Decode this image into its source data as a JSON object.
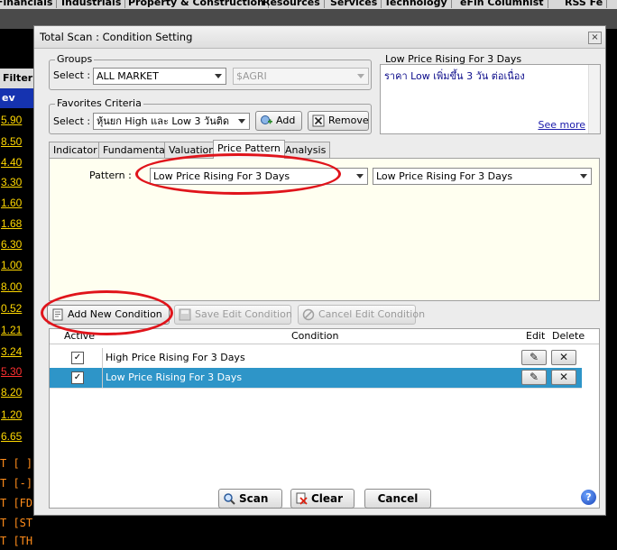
{
  "background": {
    "menu": [
      "Financials",
      "Industrials",
      "Property & Construction",
      "Resources",
      "Services",
      "Technology",
      "eFin Columnist",
      "RSS Fe"
    ],
    "filter_label": "Filter",
    "column_label": "ev",
    "values": [
      "5.90",
      "8.50",
      "4.40",
      "3.30",
      "1.60",
      "1.68",
      "6.30",
      "1.00",
      "8.00",
      "0.52",
      "1.21",
      "3.24",
      "5.30",
      "8.20",
      "1.20",
      "6.65"
    ],
    "command_lines": [
      "T [ ]",
      "T [-]",
      "T [FD",
      "T [ST",
      "T [TH"
    ]
  },
  "dialog": {
    "title": "Total Scan : Condition Setting",
    "close_glyph": "×"
  },
  "groups": {
    "legend": "Groups",
    "select_label": "Select :",
    "market_value": "ALL MARKET",
    "sector_value": "$AGRI"
  },
  "favorites": {
    "legend": "Favorites Criteria",
    "select_label": "Select :",
    "value": "หุ้นยก High และ Low 3 วันติด",
    "add_label": "Add",
    "remove_label": "Remove"
  },
  "description": {
    "legend": "Low Price Rising For 3 Days",
    "text": "ราคา Low เพิ่มขึ้น 3 วัน ต่อเนื่อง",
    "see_more": "See more"
  },
  "tabs": [
    {
      "label": "Indicator",
      "active": false
    },
    {
      "label": "Fundamental",
      "active": false
    },
    {
      "label": "Valuation",
      "active": false
    },
    {
      "label": "Price Pattern",
      "active": true
    },
    {
      "label": "Analysis",
      "active": false
    }
  ],
  "pattern": {
    "label": "Pattern :",
    "primary_value": "Low Price Rising For 3 Days",
    "secondary_value": "Low Price Rising For 3 Days"
  },
  "actions": {
    "add_new": "Add New Condition",
    "save_edit": "Save Edit Condition",
    "cancel_edit": "Cancel Edit Condition"
  },
  "conditions_table": {
    "headers": {
      "active": "Active",
      "condition": "Condition",
      "edit": "Edit",
      "delete": "Delete"
    },
    "rows": [
      {
        "active": true,
        "condition": "High Price Rising For 3 Days",
        "selected": false
      },
      {
        "active": true,
        "condition": "Low Price Rising For 3 Days",
        "selected": true
      }
    ],
    "checkmark": "✓",
    "edit_glyph": "✎",
    "delete_glyph": "✕"
  },
  "footer": {
    "scan": "Scan",
    "clear": "Clear",
    "cancel": "Cancel",
    "help": "?"
  },
  "colors": {
    "selection": "#2e95c8",
    "highlight_ellipse": "#e0141b",
    "value_yellow": "#ffd800",
    "value_red": "#ff3030"
  }
}
